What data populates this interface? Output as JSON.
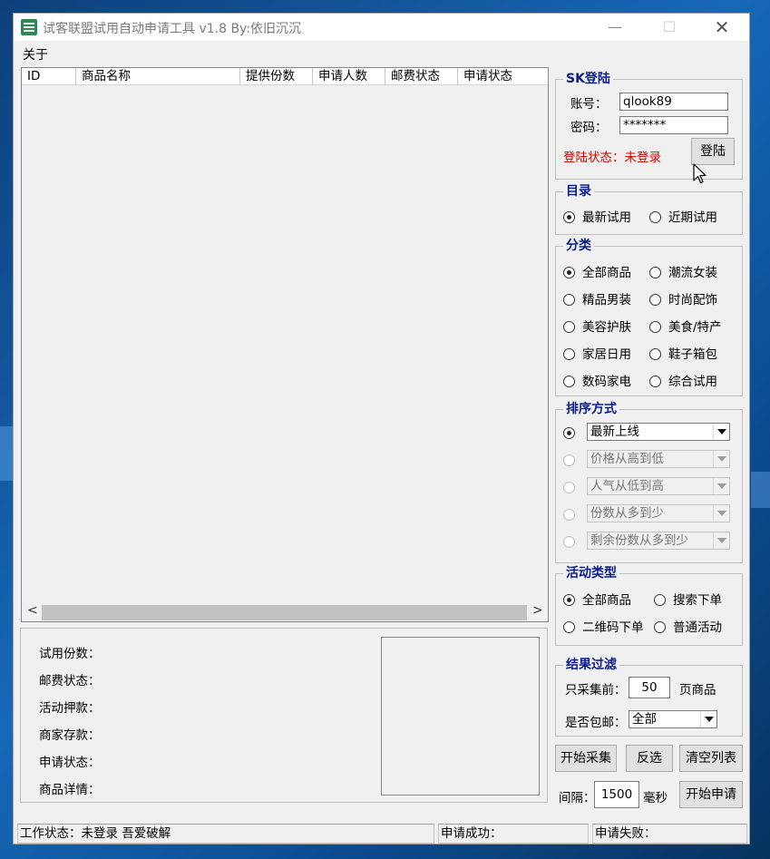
{
  "window": {
    "title": "试客联盟试用自动申请工具 v1.8  By:依旧沉沉",
    "min_glyph": "—",
    "max_glyph": "☐",
    "close_glyph": "✕"
  },
  "menu": {
    "about": "关于"
  },
  "listview": {
    "columns": [
      "ID",
      "商品名称",
      "提供份数",
      "申请人数",
      "邮费状态",
      "申请状态"
    ],
    "rows": [],
    "scroll_left": "<",
    "scroll_right": ">"
  },
  "detail": {
    "labels": [
      "试用份数：",
      "邮费状态：",
      "活动押款：",
      "商家存款：",
      "申请状态：",
      "商品详情："
    ]
  },
  "login": {
    "title": "SK登陆",
    "account_label": "账号：",
    "account_value": "qlook89",
    "password_label": "密码：",
    "password_value": "*******",
    "status_text": "登陆状态：未登录",
    "login_button": "登陆"
  },
  "catalog": {
    "title": "目录",
    "options": [
      {
        "label": "最新试用",
        "checked": true
      },
      {
        "label": "近期试用",
        "checked": false
      }
    ]
  },
  "category": {
    "title": "分类",
    "options": [
      {
        "label": "全部商品",
        "checked": true
      },
      {
        "label": "潮流女装",
        "checked": false
      },
      {
        "label": "精品男装",
        "checked": false
      },
      {
        "label": "时尚配饰",
        "checked": false
      },
      {
        "label": "美容护肤",
        "checked": false
      },
      {
        "label": "美食/特产",
        "checked": false
      },
      {
        "label": "家居日用",
        "checked": false
      },
      {
        "label": "鞋子箱包",
        "checked": false
      },
      {
        "label": "数码家电",
        "checked": false
      },
      {
        "label": "综合试用",
        "checked": false
      }
    ]
  },
  "sort": {
    "title": "排序方式",
    "options": [
      {
        "value": "最新上线",
        "checked": true,
        "enabled": true
      },
      {
        "value": "价格从高到低",
        "checked": false,
        "enabled": false
      },
      {
        "value": "人气从低到高",
        "checked": false,
        "enabled": false
      },
      {
        "value": "份数从多到少",
        "checked": false,
        "enabled": false
      },
      {
        "value": "剩余份数从多到少",
        "checked": false,
        "enabled": false
      }
    ]
  },
  "activity": {
    "title": "活动类型",
    "options": [
      {
        "label": "全部商品",
        "checked": true
      },
      {
        "label": "搜索下单",
        "checked": false
      },
      {
        "label": "二维码下单",
        "checked": false
      },
      {
        "label": "普通活动",
        "checked": false
      }
    ]
  },
  "filter": {
    "title": "结果过滤",
    "collect_prefix": "只采集前：",
    "pages_value": "50",
    "collect_suffix": "页商品",
    "shipping_label": "是否包邮：",
    "shipping_value": "全部"
  },
  "actions": {
    "start_collect": "开始采集",
    "invert": "反选",
    "clear_list": "清空列表",
    "interval_label": "间隔：",
    "interval_value": "1500",
    "interval_unit": "毫秒",
    "start_apply": "开始申请"
  },
  "status": {
    "work_status": "工作状态：未登录    吾爱破解",
    "success": "申请成功：",
    "failure": "申请失败："
  },
  "icons": {
    "app": "app-logo-icon",
    "cursor": "mouse-pointer-icon"
  }
}
